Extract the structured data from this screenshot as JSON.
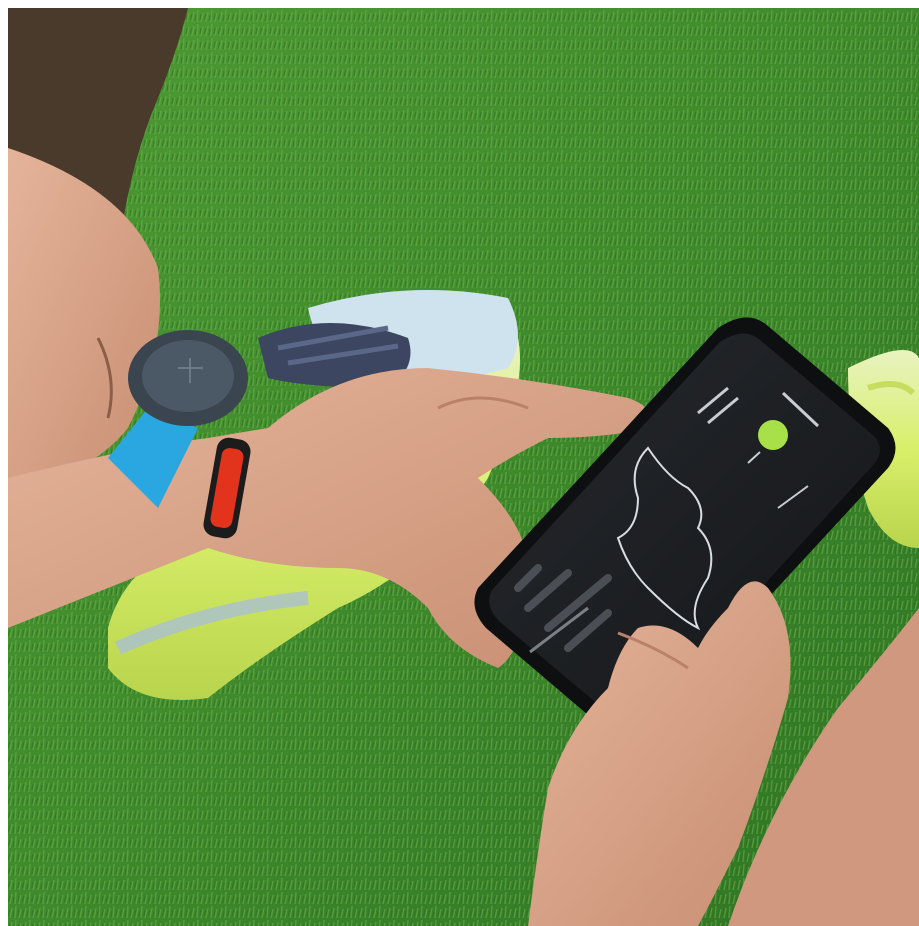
{
  "scene": {
    "description_colors": {
      "grass": "#3f8a2c",
      "grass_light": "#6fb04a",
      "skin": "#d9a58a",
      "hair": "#4a3a2c",
      "watch_strap_blue": "#2aa7e0",
      "watch_strap_red": "#e2341d",
      "shoe_yellow": "#d8ef6a",
      "phone_screen": "#1e2023",
      "app_accent": "#a8e04a"
    }
  }
}
